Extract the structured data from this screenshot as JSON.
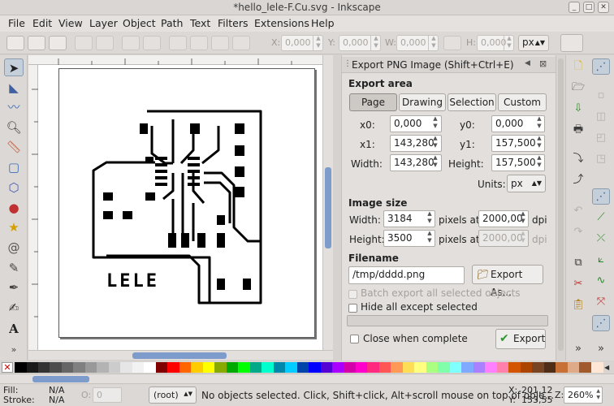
{
  "window": {
    "title": "*hello_lele-F.Cu.svg - Inkscape"
  },
  "menu": [
    "File",
    "Edit",
    "View",
    "Layer",
    "Object",
    "Path",
    "Text",
    "Filters",
    "Extensions",
    "Help"
  ],
  "toolbar": {
    "x_label": "X:",
    "x_value": "0,000",
    "y_label": "Y:",
    "y_value": "0,000",
    "w_label": "W:",
    "w_value": "0,000",
    "h_label": "H:",
    "h_value": "0,000",
    "unit": "px"
  },
  "drawing": {
    "board_text": "LELE"
  },
  "export_dialog": {
    "title": "Export PNG Image (Shift+Ctrl+E)",
    "export_area_label": "Export area",
    "area_buttons": [
      "Page",
      "Drawing",
      "Selection",
      "Custom"
    ],
    "active_area": "Page",
    "x0_label": "x0:",
    "x0": "0,000",
    "y0_label": "y0:",
    "y0": "0,000",
    "x1_label": "x1:",
    "x1": "143,280",
    "y1_label": "y1:",
    "y1": "157,500",
    "width_label": "Width:",
    "width": "143,280",
    "height_label": "Height:",
    "height": "157,500",
    "units_label": "Units:",
    "units": "px",
    "image_size_label": "Image size",
    "img_width_label": "Width:",
    "img_width": "3184",
    "img_height_label": "Height:",
    "img_height": "3500",
    "pixels_at": "pixels at",
    "dpi_value": "2000,00",
    "dpi_value_disabled": "2000,00",
    "dpi": "dpi",
    "filename_label": "Filename",
    "filename": "/tmp/dddd.png",
    "export_as_label": "Export As...",
    "batch_label": "Batch export all selected objects",
    "hide_label": "Hide all except selected",
    "close_label": "Close when complete",
    "export_label": "Export"
  },
  "status": {
    "fill_label": "Fill:",
    "fill_value": "N/A",
    "stroke_label": "Stroke:",
    "stroke_value": "N/A",
    "opacity_label": "O:",
    "opacity_value": "0",
    "layer": "(root)",
    "message": "No objects selected. Click, Shift+click, Alt+scroll mouse on top of obje...",
    "x_label": "X:",
    "x_coord": "201,12",
    "y_label": "Y:",
    "y_coord": "153,55",
    "z_label": "Z:",
    "zoom": "260%"
  },
  "palette_colors": [
    "#000000",
    "#1a1a1a",
    "#333333",
    "#4d4d4d",
    "#666666",
    "#808080",
    "#999999",
    "#b3b3b3",
    "#cccccc",
    "#e6e6e6",
    "#f2f2f2",
    "#ffffff",
    "#800000",
    "#ff0000",
    "#ff6600",
    "#ffcc00",
    "#ffff00",
    "#88aa00",
    "#00aa00",
    "#00ff00",
    "#00aa88",
    "#00ffcc",
    "#0088aa",
    "#00ccff",
    "#0044aa",
    "#0000ff",
    "#5500d4",
    "#aa00ff",
    "#d400aa",
    "#ff00cc",
    "#ff2a7f",
    "#ff5555",
    "#ff9955",
    "#ffdd55",
    "#ffff80",
    "#aaff80",
    "#80ffaa",
    "#80ffff",
    "#80aaff",
    "#aa80ff",
    "#ff80ff",
    "#ff80aa",
    "#d45500",
    "#aa4400",
    "#784421",
    "#502d16",
    "#c87137",
    "#deaa87",
    "#a05a2c",
    "#ffe6d5"
  ]
}
